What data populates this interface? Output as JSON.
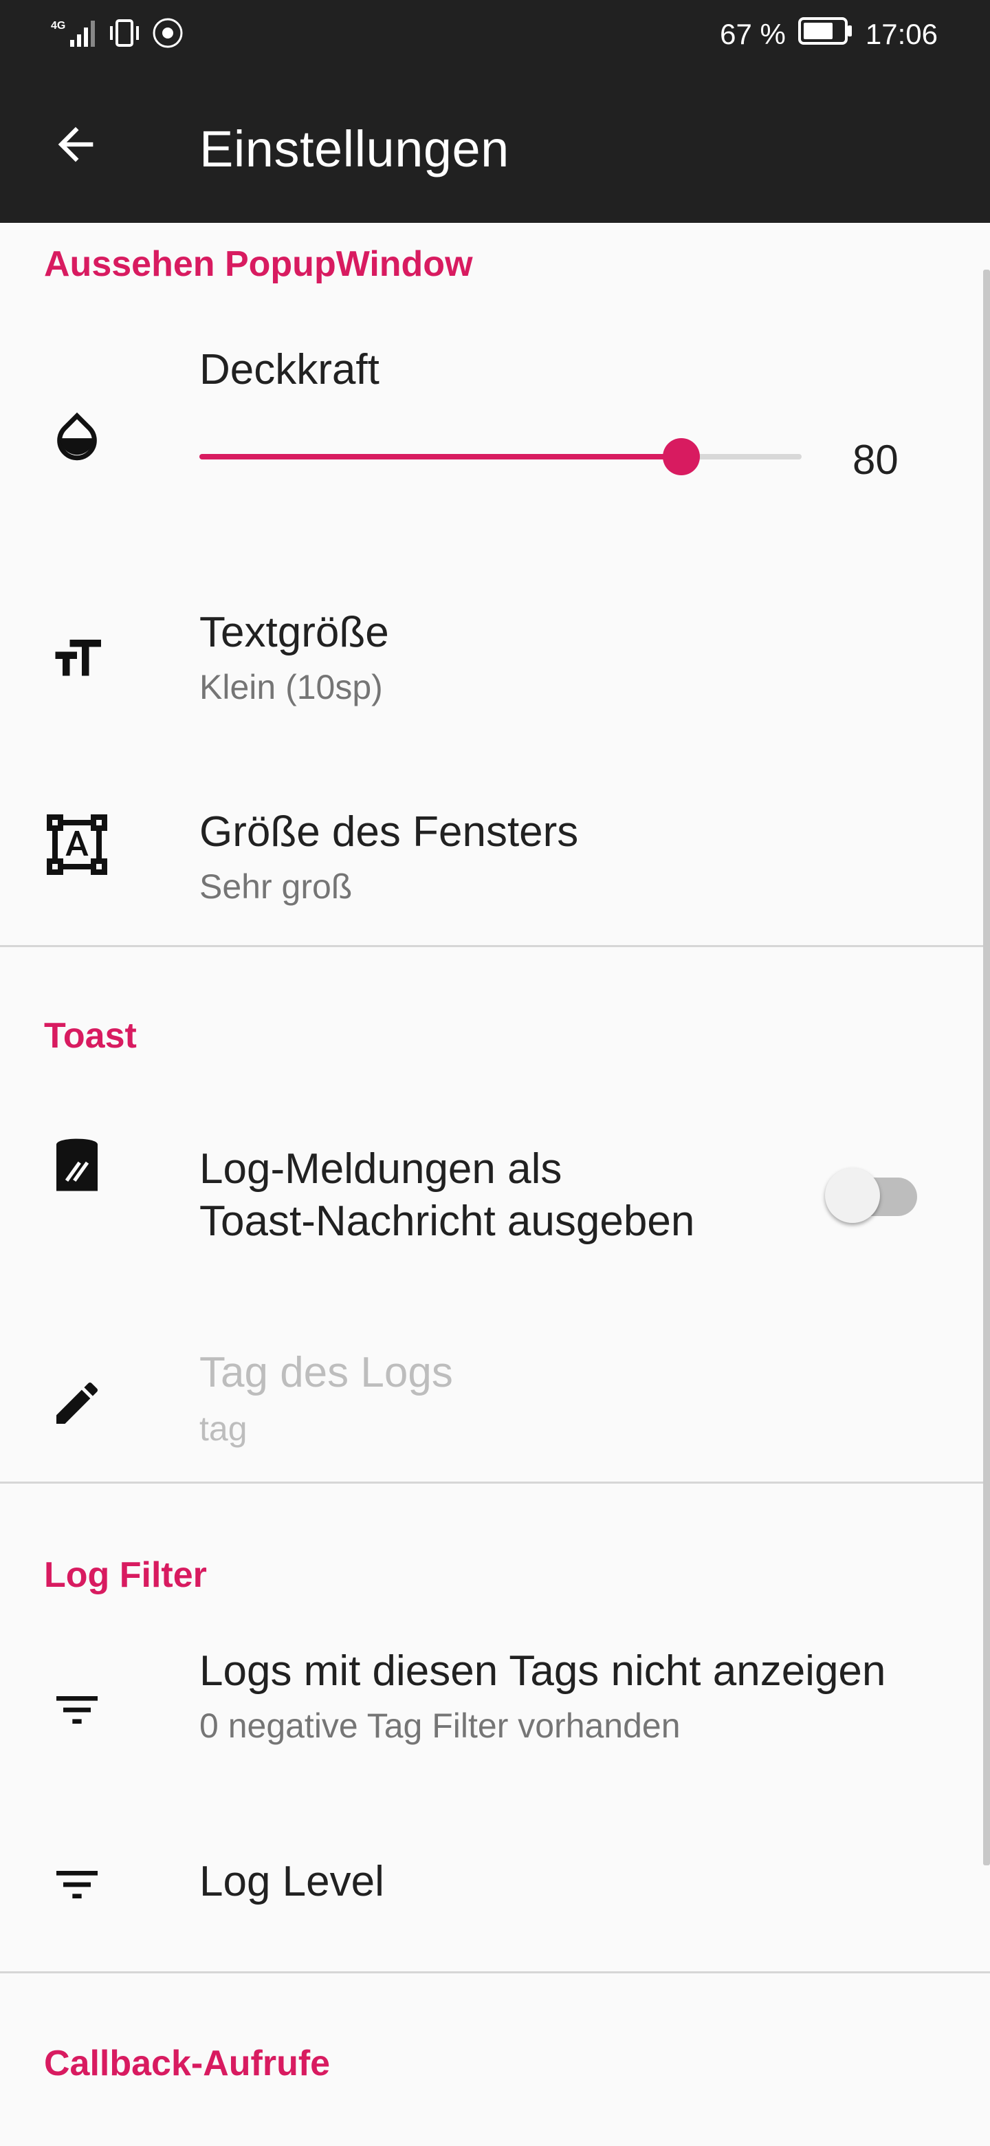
{
  "status_bar": {
    "network": "4G",
    "battery": "67 %",
    "time": "17:06"
  },
  "app_bar": {
    "title": "Einstellungen",
    "back_icon": "arrow-back-icon"
  },
  "sections": {
    "popup": {
      "header": "Aussehen PopupWindow",
      "opacity": {
        "title": "Deckkraft",
        "value": "80",
        "fill_fraction": 0.8,
        "icon": "opacity-drop-icon"
      },
      "text_size": {
        "title": "Textgröße",
        "summary": "Klein (10sp)",
        "icon": "text-size-icon"
      },
      "window_size": {
        "title": "Größe des Fensters",
        "summary": "Sehr groß",
        "icon": "format-shapes-icon"
      }
    },
    "toast": {
      "header": "Toast",
      "log_toast": {
        "title_line1": "Log-Meldungen als",
        "title_line2": "Toast-Nachricht ausgeben",
        "enabled": false,
        "icon": "toast-icon"
      },
      "log_tag": {
        "title": "Tag des Logs",
        "summary": "tag",
        "icon": "pencil-icon"
      }
    },
    "log_filter": {
      "header": "Log Filter",
      "hide_tags": {
        "title": "Logs mit diesen Tags nicht anzeigen",
        "summary": "0 negative Tag Filter vorhanden",
        "icon": "filter-icon"
      },
      "log_level": {
        "title": "Log Level",
        "icon": "filter-icon"
      }
    },
    "callbacks": {
      "header": "Callback-Aufrufe"
    }
  },
  "colors": {
    "accent": "#d81b60",
    "app_bar": "#212121",
    "background": "#fafafa"
  }
}
